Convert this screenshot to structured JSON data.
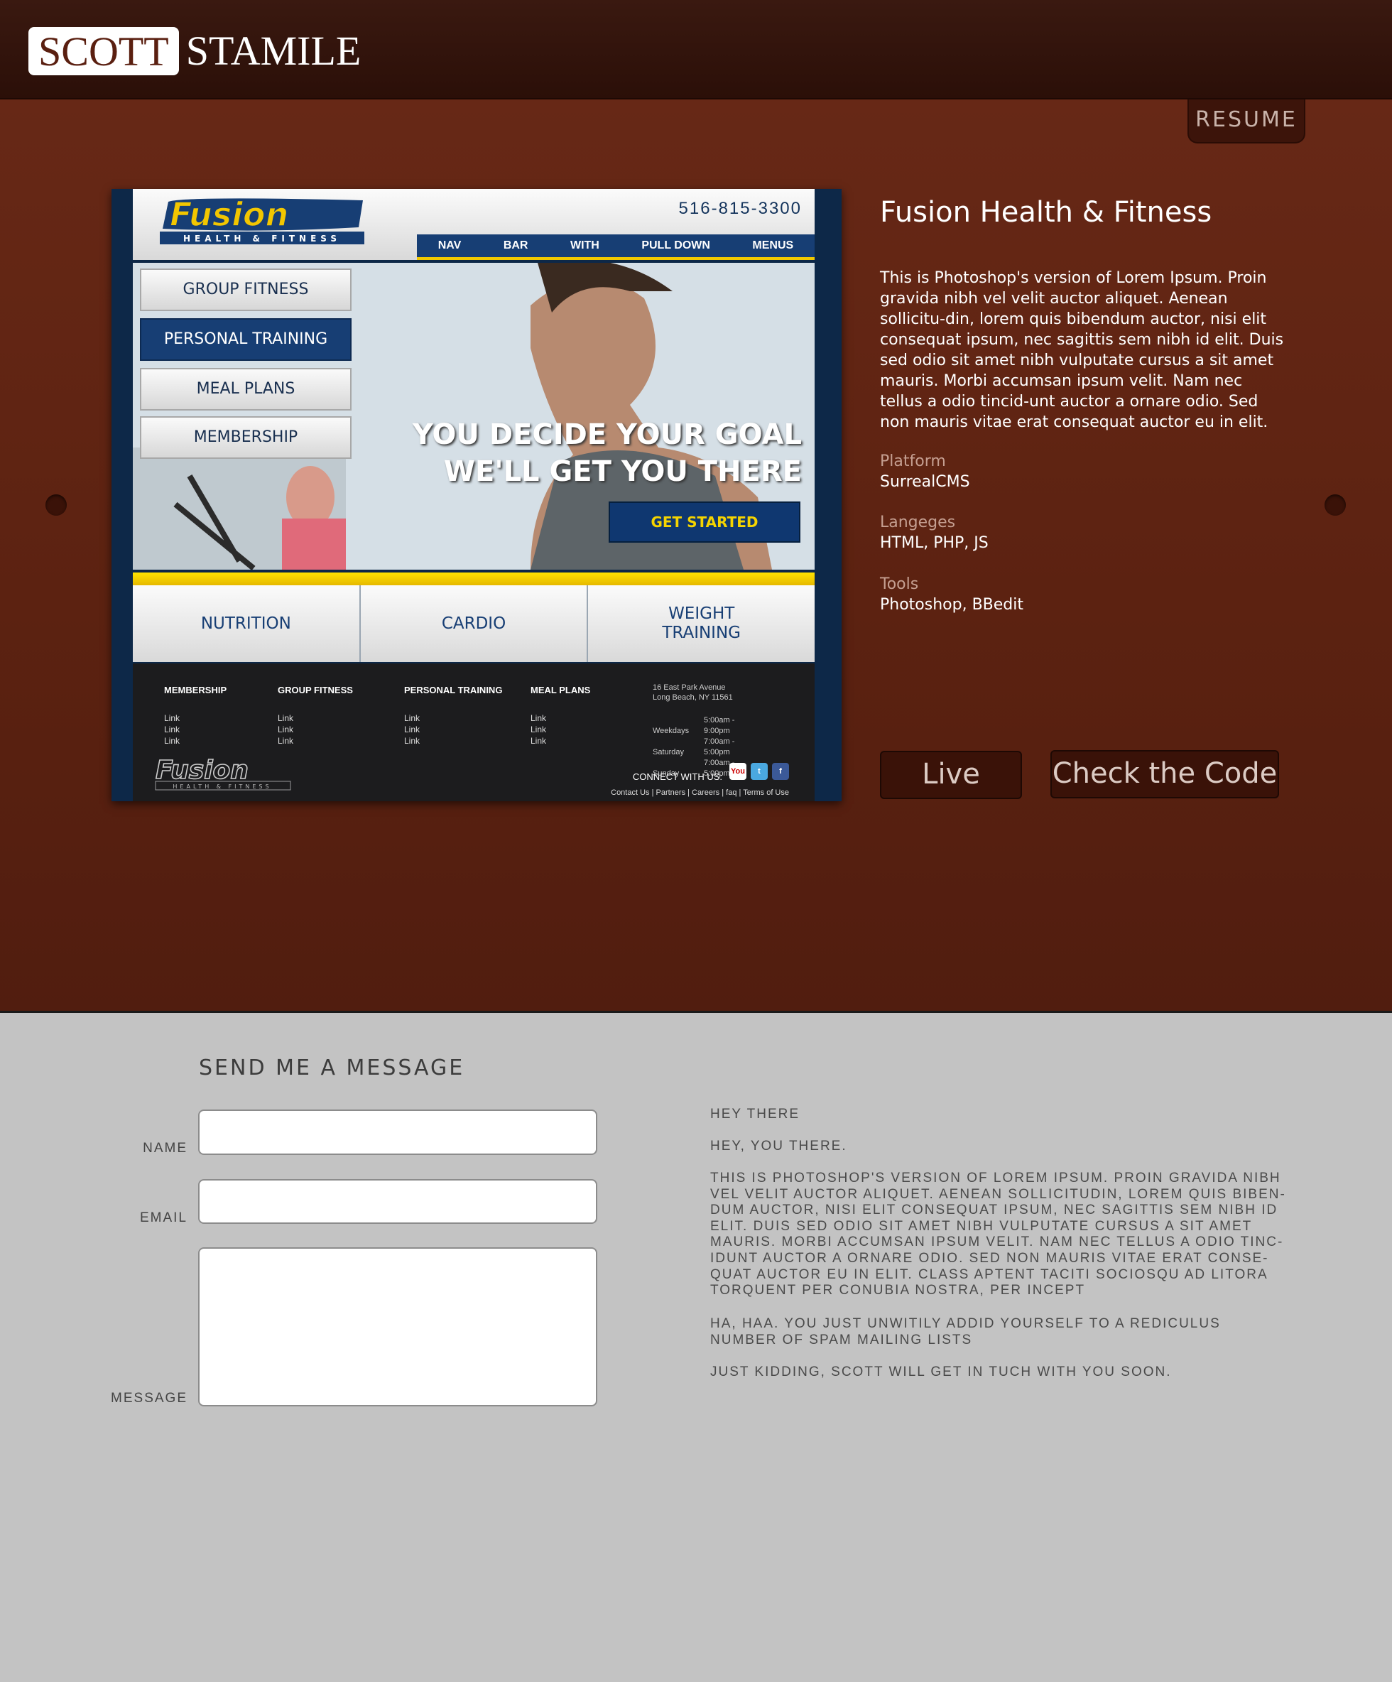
{
  "header": {
    "logo_first": "SCOTT",
    "logo_last": "STAMILE",
    "resume_tab": "RESUME"
  },
  "mock_site": {
    "phone": "516-815-3300",
    "logo_text": "Fusion",
    "logo_sub": "HEALTH & FITNESS",
    "nav": [
      "NAV",
      "BAR",
      "WITH",
      "PULL DOWN",
      "MENUS"
    ],
    "side_menu": [
      "GROUP FITNESS",
      "PERSONAL TRAINING",
      "MEAL PLANS",
      "MEMBERSHIP"
    ],
    "headline_1": "YOU DECIDE YOUR GOAL",
    "headline_2": "WE'LL GET YOU THERE",
    "cta": "GET STARTED",
    "tiles": [
      "NUTRITION",
      "CARDIO",
      "WEIGHT\nTRAINING"
    ],
    "footer_columns": [
      {
        "title": "MEMBERSHIP",
        "links": [
          "Link",
          "Link",
          "Link"
        ]
      },
      {
        "title": "GROUP FITNESS",
        "links": [
          "Link",
          "Link",
          "Link"
        ]
      },
      {
        "title": "PERSONAL TRAINING",
        "links": [
          "Link",
          "Link",
          "Link"
        ]
      },
      {
        "title": "MEAL PLANS",
        "links": [
          "Link",
          "Link",
          "Link"
        ]
      }
    ],
    "address_1": "16 East Park Avenue",
    "address_2": "Long Beach, NY 11561",
    "hours": [
      {
        "day": "Weekdays",
        "time": "5:00am - 9:00pm"
      },
      {
        "day": "Saturday",
        "time": "7:00am - 5:00pm"
      },
      {
        "day": "Sunday",
        "time": "7:00am - 5:00pm"
      }
    ],
    "connect": "CONNECT WITH US:",
    "footer_links": "Contact Us | Partners | Careers | faq | Terms of Use"
  },
  "project": {
    "title": "Fusion Health & Fitness",
    "description": "This is Photoshop's version  of Lorem Ipsum. Proin gravida nibh vel velit auctor aliquet. Aenean sollicitu-din, lorem quis bibendum auctor, nisi elit consequat ipsum, nec sagittis sem nibh id elit. Duis sed odio sit amet nibh vulputate cursus a sit amet mauris. Morbi accumsan ipsum velit. Nam nec tellus a odio tincid-unt auctor a ornare odio. Sed non  mauris vitae erat consequat auctor eu in elit.",
    "platform_label": "Platform",
    "platform": "SurrealCMS",
    "languages_label": "Langeges",
    "languages": "HTML, PHP, JS",
    "tools_label": "Tools",
    "tools": "Photoshop, BBedit",
    "live_button": "Live",
    "code_button": "Check the Code"
  },
  "contact": {
    "title": "SEND ME A MESSAGE",
    "name_label": "NAME",
    "email_label": "EMAIL",
    "message_label": "MESSAGE",
    "msg_1": "HEY THERE",
    "msg_2": "HEY, YOU THERE.",
    "msg_3": "THIS IS PHOTOSHOP'S VERSION  OF LOREM IPSUM. PROIN GRAVIDA NIBH VEL VELIT AUCTOR ALIQUET. AENEAN SOLLICITUDIN, LOREM QUIS BIBEN-DUM AUCTOR, NISI ELIT CONSEQUAT IPSUM, NEC SAGITTIS SEM NIBH ID ELIT. DUIS SED ODIO SIT AMET NIBH VULPUTATE CURSUS A SIT AMET MAURIS. MORBI ACCUMSAN IPSUM VELIT. NAM NEC TELLUS A ODIO TINC-IDUNT AUCTOR A ORNARE ODIO. SED NON  MAURIS VITAE ERAT CONSE-QUAT AUCTOR EU IN ELIT. CLASS APTENT TACITI SOCIOSQU AD LITORA TORQUENT PER CONUBIA NOSTRA, PER INCEPT",
    "msg_4": "HA, HAA. YOU JUST UNWITILY ADDID YOURSELF TO A REDICULUS NUMBER OF SPAM MAILING LISTS",
    "msg_5": "JUST KIDDING, SCOTT WILL GET IN TUCH WITH YOU SOON."
  },
  "colors": {
    "header_bg": "#2b0f08",
    "hero_bg": "#5c2211",
    "contact_bg": "#c3c3c3",
    "fusion_blue": "#173e74",
    "fusion_yellow": "#f0c800"
  }
}
